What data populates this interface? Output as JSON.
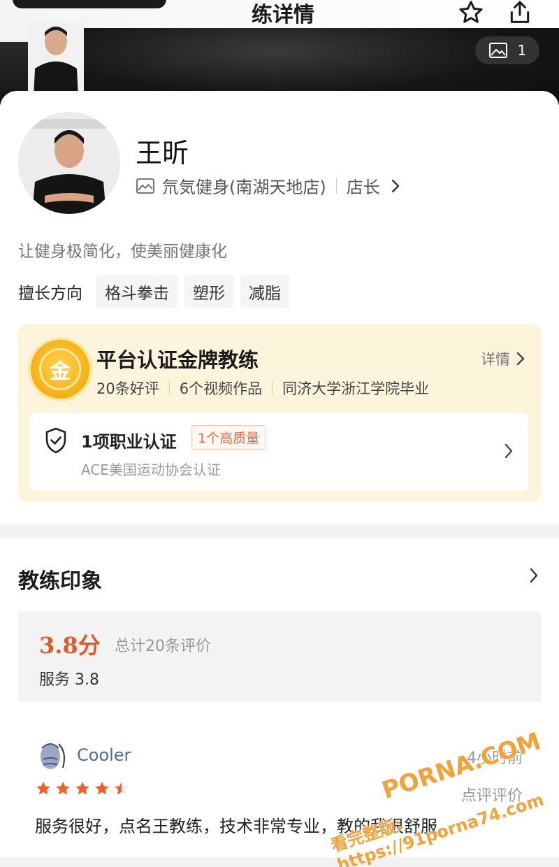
{
  "header": {
    "title": "练详情",
    "photo_count": "1"
  },
  "coach": {
    "name": "王昕",
    "store": "氘気健身(南湖天地店)",
    "role": "店长",
    "slogan": "让健身极简化，使美丽健康化",
    "skills_label": "擅长方向",
    "skills": [
      "格斗拳击",
      "塑形",
      "减脂"
    ]
  },
  "certification": {
    "badge_char": "金",
    "title": "平台认证金牌教练",
    "detail_label": "详情",
    "stats": [
      "20条好评",
      "6个视频作品",
      "同济大学浙江学院毕业"
    ],
    "qualification": {
      "title": "1项职业认证",
      "tag": "1个高质量",
      "subtitle": "ACE美国运动协会认证"
    }
  },
  "impressions": {
    "title": "教练印象",
    "score": "3.8分",
    "total": "总计20条评价",
    "service": "服务 3.8"
  },
  "review": {
    "user": "Cooler",
    "time": "4小时前",
    "type": "点评评价",
    "rating": 4.5,
    "text": "服务很好，点名王教练，技术非常专业，教的我很舒服"
  },
  "watermark": {
    "brand": "PORNA.COM",
    "url": "看完整版: https://91porna74.com"
  },
  "colors": {
    "accent": "#e0592a",
    "gold": "#f6b51a",
    "cert_bg": "#fdf4dc",
    "user_link": "#4e6d97"
  }
}
